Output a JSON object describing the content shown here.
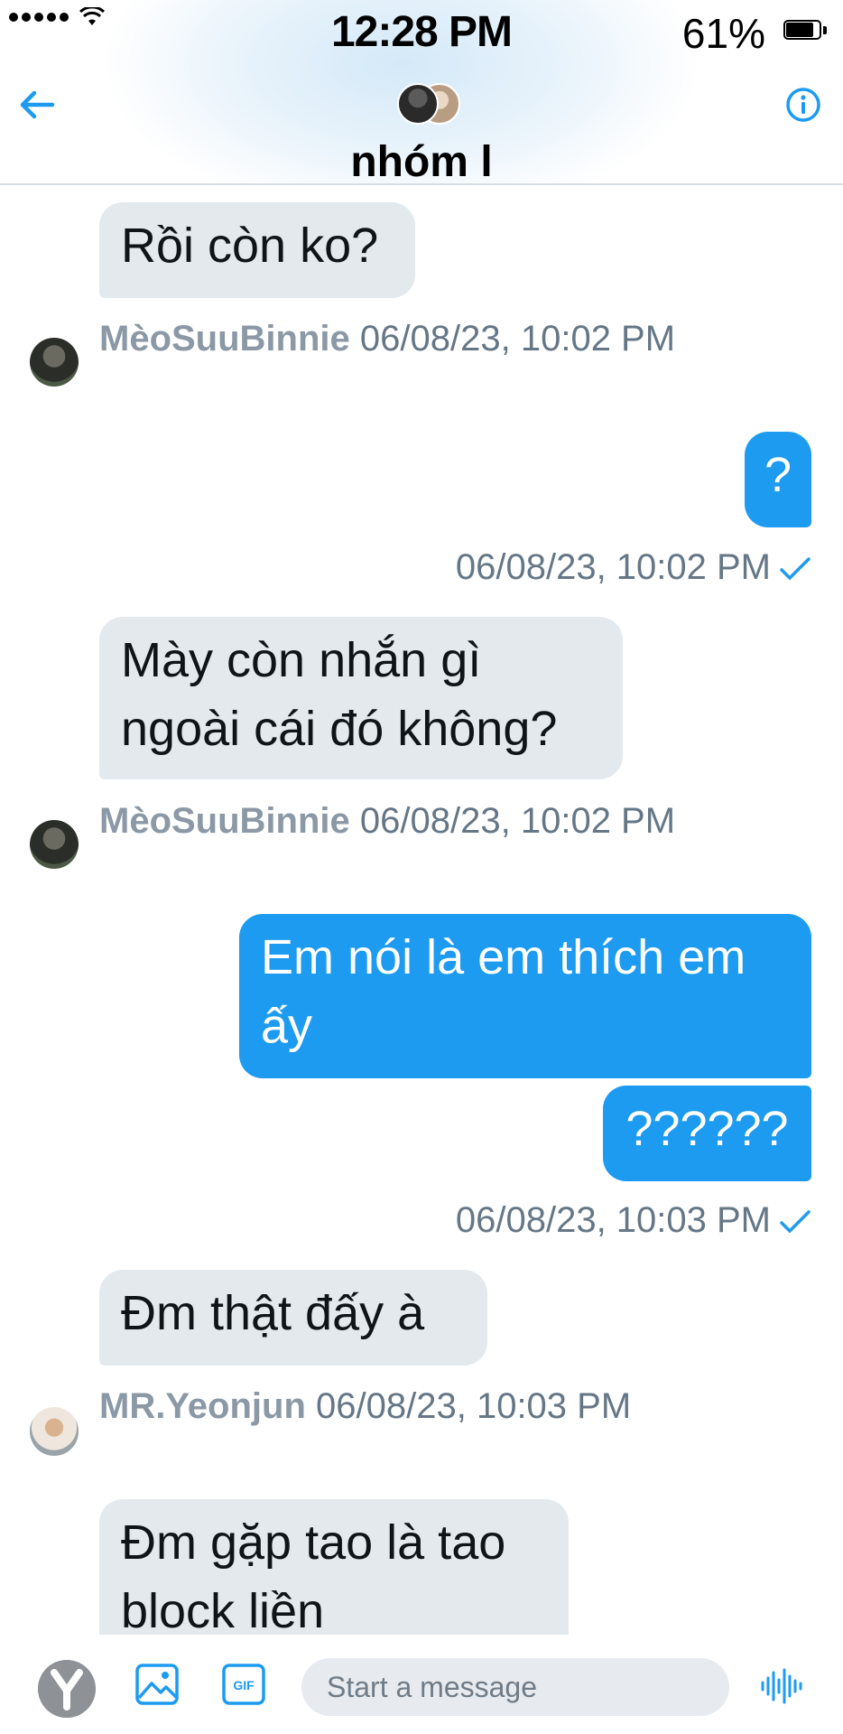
{
  "status_bar": {
    "time": "12:28 PM",
    "battery": "61%"
  },
  "header": {
    "group_name": "nhóm l",
    "icons": [
      "back-arrow-icon",
      "info-icon"
    ]
  },
  "messages": [
    {
      "type": "received",
      "text": "Rồi còn ko?",
      "sender": "MèoSuuBinnie",
      "time": "06/08/23, 10:02 PM"
    },
    {
      "type": "sent",
      "text": "?",
      "time": "06/08/23, 10:02 PM"
    },
    {
      "type": "received",
      "text": "Mày còn nhắn gì ngoài cái đó không?",
      "sender": "MèoSuuBinnie",
      "time": "06/08/23, 10:02 PM"
    },
    {
      "type": "sent",
      "text": "Em nói là em thích em ấy"
    },
    {
      "type": "sent",
      "text": "??????",
      "time": "06/08/23, 10:03 PM"
    },
    {
      "type": "received",
      "text": "Đm thật đấy à",
      "sender": "MR.Yeonjun",
      "time": "06/08/23, 10:03 PM"
    },
    {
      "type": "received",
      "text": "Đm gặp tao là tao block liền"
    }
  ],
  "composer": {
    "placeholder": "Start a message",
    "gif_label": "GIF"
  },
  "colors": {
    "accent": "#1d9bf0",
    "received_bubble": "#e4e9ee",
    "meta_text": "#657786"
  }
}
